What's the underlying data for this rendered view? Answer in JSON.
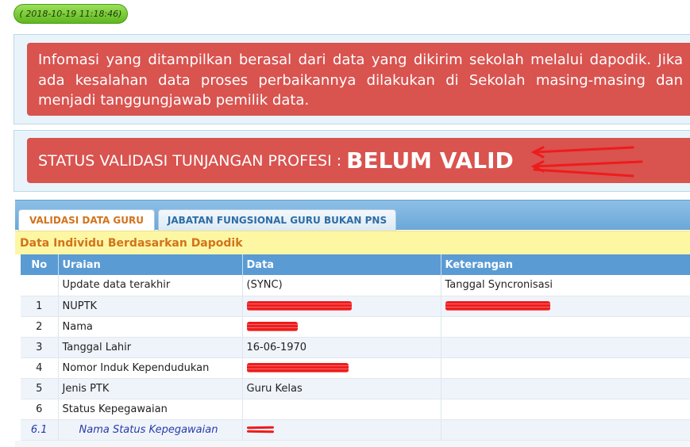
{
  "timestamp": "( 2018-10-19 11:18:46)",
  "info_alert": {
    "text": "Infomasi yang ditampilkan berasal dari data yang dikirim sekolah melalui dapodik. Jika ada kesalahan data proses perbaikannya dilakukan di Sekolah masing-masing dan menjadi tanggungjawab pemilik data."
  },
  "status_alert": {
    "label": "STATUS VALIDASI TUNJANGAN PROFESI :",
    "value": "BELUM VALID"
  },
  "tabs": [
    {
      "label": "VALIDASI DATA GURU",
      "active": true
    },
    {
      "label": "JABATAN FUNGSIONAL GURU BUKAN PNS",
      "active": false
    }
  ],
  "section_title": "Data Individu Berdasarkan Dapodik",
  "table": {
    "headers": [
      "No",
      "Uraian",
      "Data",
      "Keterangan"
    ],
    "rows": [
      {
        "no": "",
        "uraian": "Update data terakhir",
        "data": "(SYNC)",
        "keterangan": "Tanggal Syncronisasi"
      },
      {
        "no": "1",
        "uraian": "NUPTK",
        "data": "",
        "keterangan": ""
      },
      {
        "no": "2",
        "uraian": "Nama",
        "data": "",
        "keterangan": ""
      },
      {
        "no": "3",
        "uraian": "Tanggal Lahir",
        "data": "16-06-1970",
        "keterangan": ""
      },
      {
        "no": "4",
        "uraian": "Nomor Induk Kependudukan",
        "data": "",
        "keterangan": ""
      },
      {
        "no": "5",
        "uraian": "Jenis PTK",
        "data": "Guru Kelas",
        "keterangan": ""
      },
      {
        "no": "6",
        "uraian": "Status Kepegawaian",
        "data": "",
        "keterangan": ""
      },
      {
        "no": "6.1",
        "uraian": "Nama Status Kepegawaian",
        "data": "",
        "keterangan": ""
      }
    ]
  },
  "colors": {
    "alert_red": "#d9534f",
    "header_blue": "#5a9bd4",
    "accent_orange": "#d2731b",
    "pill_green": "#7ccb3a",
    "annotation_red": "#ee1c1c"
  }
}
